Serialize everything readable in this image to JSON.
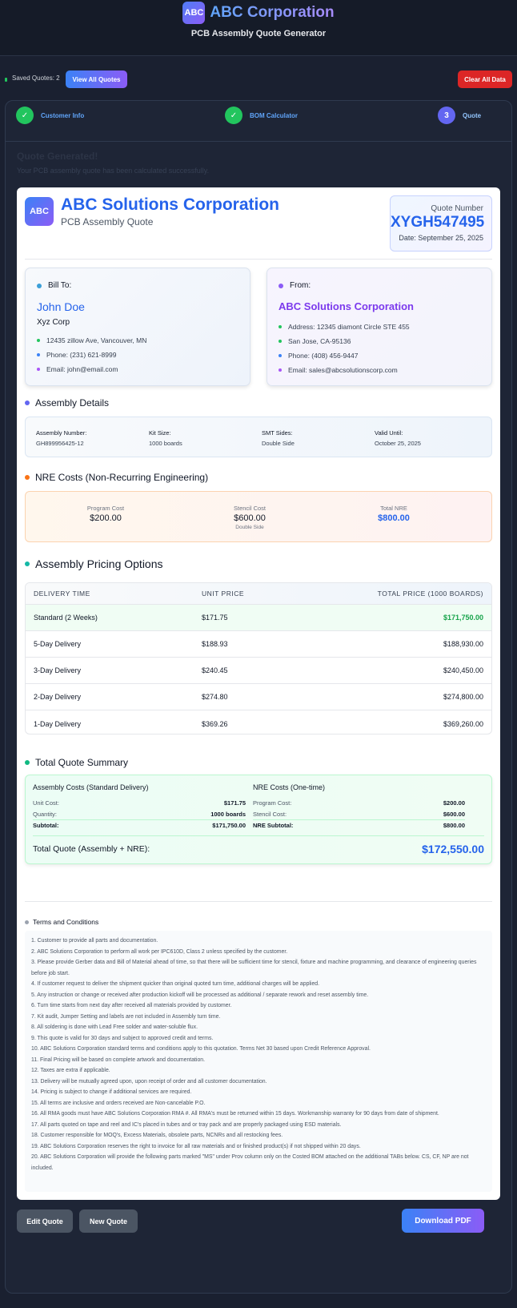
{
  "header": {
    "logo_text": "ABC",
    "app_name": "ABC Corporation",
    "subtitle": "PCB Assembly Quote Generator"
  },
  "toolbar": {
    "saved_text": "Saved Quotes: 2",
    "view_all_label": "View All Quotes",
    "clear_all_label": "Clear All Data"
  },
  "steps": [
    {
      "label": "Customer Info",
      "state": "done",
      "icon": "check-icon"
    },
    {
      "label": "BOM Calculator",
      "state": "done",
      "icon": "check-icon"
    },
    {
      "label": "Quote",
      "state": "active",
      "number": "3"
    }
  ],
  "step_glyph": "✓",
  "result": {
    "title": "Quote Generated!",
    "subtitle": "Your PCB assembly quote has been calculated successfully."
  },
  "quote": {
    "logo_text": "ABC",
    "company": "ABC Solutions Corporation",
    "type": "PCB Assembly Quote",
    "number_label": "Quote Number",
    "number": "XYGH547495",
    "date": "Date: September 25, 2025"
  },
  "bill_to": {
    "heading": "Bill To:",
    "name": "John Doe",
    "company": "Xyz Corp",
    "lines": [
      "12435 zillow Ave, Vancouver, MN",
      "Phone: (231) 621-8999",
      "Email: john@email.com"
    ]
  },
  "from": {
    "heading": "From:",
    "name": "ABC Solutions Corporation",
    "lines": [
      "Address: 12345 diamont Circle STE 455",
      "San Jose, CA-95136",
      "Phone: (408) 456-9447",
      "Email: sales@abcsolutionscorp.com"
    ]
  },
  "assembly": {
    "title": "Assembly Details",
    "fields": [
      {
        "label": "Assembly Number:",
        "value": "GH899956425-12"
      },
      {
        "label": "Kit Size:",
        "value": "1000 boards"
      },
      {
        "label": "SMT Sides:",
        "value": "Double Side"
      },
      {
        "label": "Valid Until:",
        "value": "October 25, 2025"
      }
    ]
  },
  "nre": {
    "title": "NRE Costs (Non-Recurring Engineering)",
    "program": {
      "label": "Program Cost",
      "value": "$200.00"
    },
    "stencil": {
      "label": "Stencil Cost",
      "value": "$600.00",
      "note": "Double Side"
    },
    "total": {
      "label": "Total NRE",
      "value": "$800.00"
    }
  },
  "pricing": {
    "title": "Assembly Pricing Options",
    "headers": [
      "DELIVERY TIME",
      "UNIT PRICE",
      "TOTAL PRICE (1000 BOARDS)"
    ],
    "rows": [
      [
        "Standard (2 Weeks)",
        "$171.75",
        "$171,750.00"
      ],
      [
        "5-Day Delivery",
        "$188.93",
        "$188,930.00"
      ],
      [
        "3-Day Delivery",
        "$240.45",
        "$240,450.00"
      ],
      [
        "2-Day Delivery",
        "$274.80",
        "$274,800.00"
      ],
      [
        "1-Day Delivery",
        "$369.26",
        "$369,260.00"
      ]
    ]
  },
  "summary": {
    "title": "Total Quote Summary",
    "assembly_head": "Assembly Costs (Standard Delivery)",
    "assembly_lines": [
      {
        "label": "Unit Cost:",
        "value": "$171.75"
      },
      {
        "label": "Quantity:",
        "value": "1000 boards"
      },
      {
        "label": "Subtotal:",
        "value": "$171,750.00"
      }
    ],
    "nre_head": "NRE Costs (One-time)",
    "nre_lines": [
      {
        "label": "Program Cost:",
        "value": "$200.00"
      },
      {
        "label": "Stencil Cost:",
        "value": "$600.00"
      },
      {
        "label": "NRE Subtotal:",
        "value": "$800.00"
      }
    ],
    "total_label": "Total Quote (Assembly + NRE):",
    "total_value": "$172,550.00"
  },
  "terms": {
    "title": "Terms and Conditions",
    "items": [
      "1. Customer to provide all parts and documentation.",
      "2. ABC Solutions Corporation to perform all work per IPC610D, Class 2 unless specified by the customer.",
      "3. Please provide Gerber data and Bill of Material ahead of time, so that there will be sufficient time for stencil, fixture and machine programming, and clearance of engineering queries before job start.",
      "4. If customer request to deliver the shipment quicker than original quoted turn time, additional charges will be applied.",
      "5. Any instruction or change or received after production kickoff will be processed as additional / separate rework and reset assembly time.",
      "6. Turn time starts from next day after received all materials provided by customer.",
      "7. Kit audit, Jumper Setting and labels are not included in Assembly turn time.",
      "8. All soldering is done with Lead Free solder and water-soluble flux.",
      "9. This quote is valid for 30 days and subject to approved credit and terms.",
      "10. ABC Solutions Corporation standard terms and conditions apply to this quotation. Terms Net 30 based upon Credit Reference Approval.",
      "11. Final Pricing will be based on complete artwork and documentation.",
      "12. Taxes are extra if applicable.",
      "13. Delivery will be mutually agreed upon, upon receipt of order and all customer documentation.",
      "14. Pricing is subject to change if additional services are required.",
      "15. All terms are inclusive and orders received are Non-cancelable P.O.",
      "16. All RMA goods must have ABC Solutions Corporation RMA #. All RMA's must be returned within 15 days. Workmanship warranty for 90 days from date of shipment.",
      "17. All parts quoted on tape and reel and IC's placed in tubes and or tray pack and are properly packaged using ESD materials.",
      "18. Customer responsible for MOQ's, Excess Materials, obsolete parts, NCNRs and all restocking fees.",
      "19. ABC Solutions Corporation reserves the right to invoice for all raw materials and or finished product(s) if not shipped within 20 days.",
      "20. ABC Solutions Corporation will provide the following parts marked \"MS\" under Prov column only on the Costed BOM attached on the additional TABs below. CS, CF, NP are not included."
    ]
  },
  "actions": {
    "edit_label": "Edit Quote",
    "new_label": "New Quote",
    "pdf_label": "Download PDF"
  },
  "colors": {
    "accent_blue": "#2563eb",
    "accent_purple": "#7c3aed",
    "success_green": "#16a34a",
    "danger_red": "#dc2626"
  }
}
